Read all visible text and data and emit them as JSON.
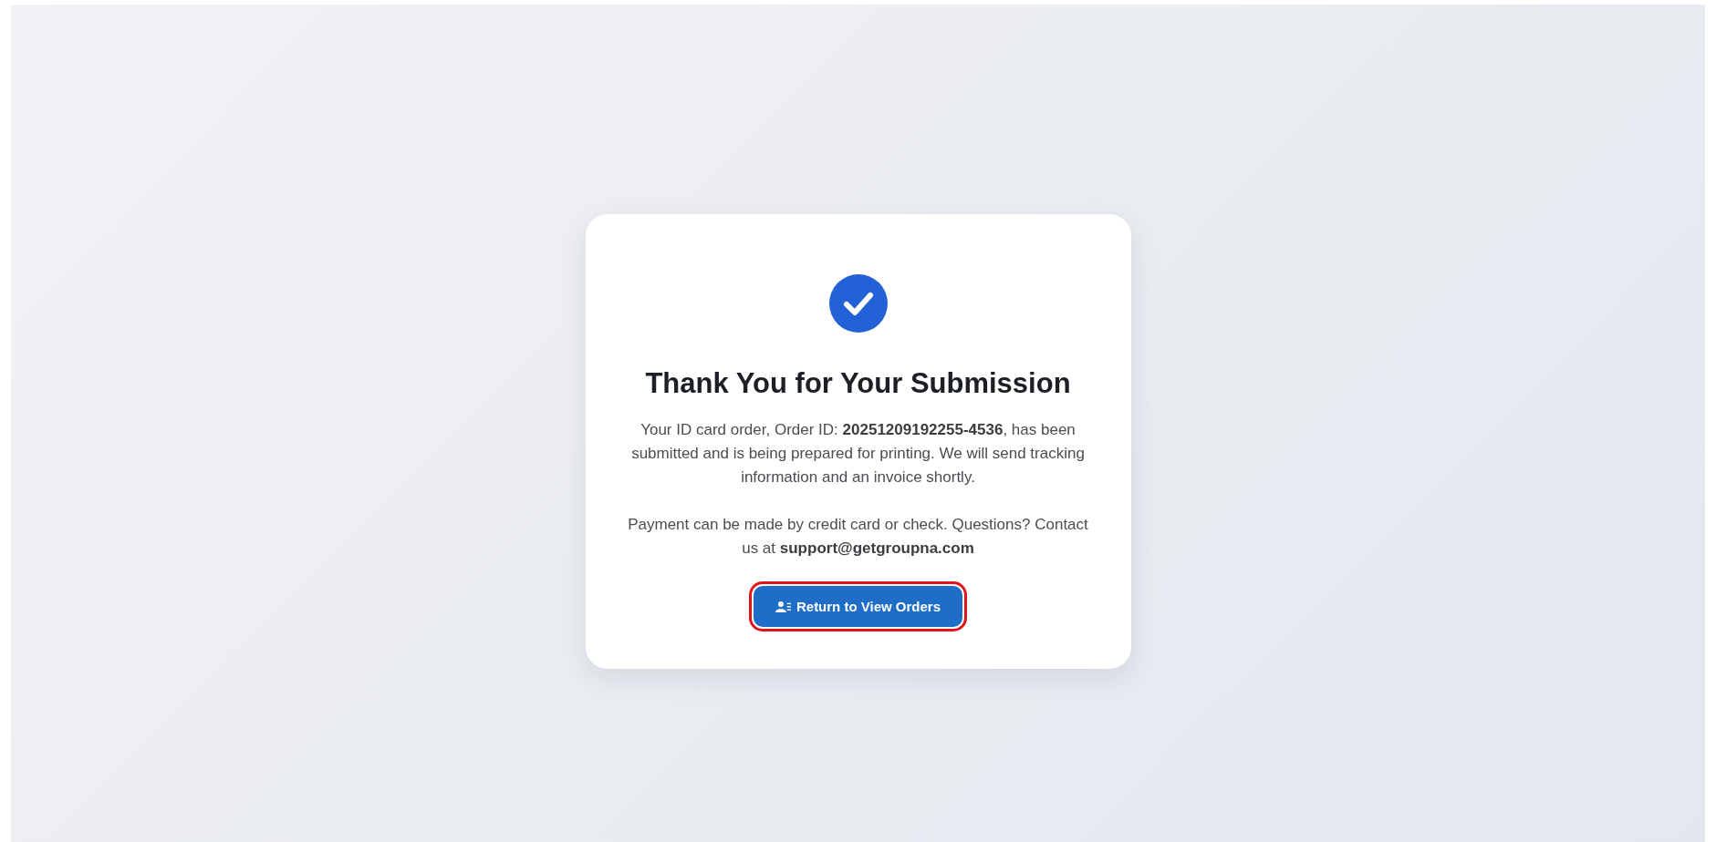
{
  "title": "Thank You for Your Submission",
  "paragraphs": [
    "Your ID card order, Order ID: **20251209192255-4536**, has been submitted and is being prepared for printing. We will send tracking information and an invoice shortly.",
    "Payment can be made by credit card or check. Questions? Contact us at **support@getgroupna.com**"
  ],
  "button": {
    "label": "Return to View Orders",
    "highlighted": true
  }
}
